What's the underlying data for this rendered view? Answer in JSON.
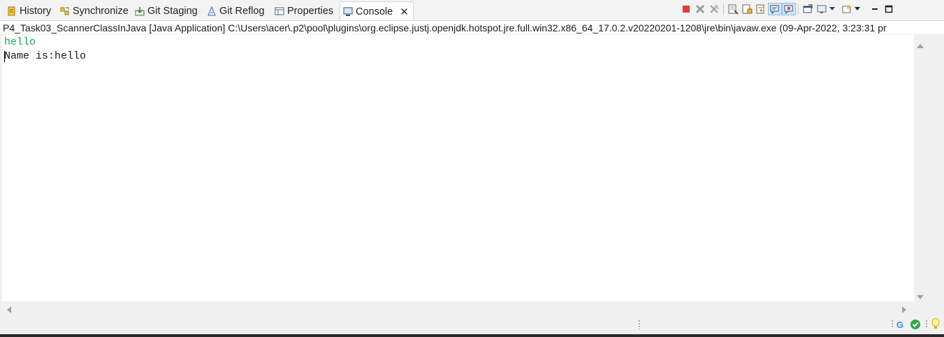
{
  "tabs": [
    {
      "label": "History",
      "icon": "history-icon"
    },
    {
      "label": "Synchronize",
      "icon": "synchronize-icon"
    },
    {
      "label": "Git Staging",
      "icon": "git-staging-icon"
    },
    {
      "label": "Git Reflog",
      "icon": "git-reflog-icon"
    },
    {
      "label": "Properties",
      "icon": "properties-icon"
    },
    {
      "label": "Console",
      "icon": "console-icon",
      "active": true
    }
  ],
  "toolbar_icons": [
    "terminate-icon",
    "remove-launch-icon",
    "remove-all-terminated-icon",
    "clear-console-icon",
    "scroll-lock-icon",
    "word-wrap-icon",
    "show-console-on-stdout-icon",
    "show-console-on-stderr-icon",
    "pin-console-icon",
    "display-selected-console-icon",
    "open-console-icon",
    "minimize-icon",
    "maximize-icon"
  ],
  "console": {
    "process_path": "P4_Task03_ScannerClassInJava [Java Application] C:\\Users\\acer\\.p2\\pool\\plugins\\org.eclipse.justj.openjdk.hotspot.jre.full.win32.x86_64_17.0.2.v20220201-1208\\jre\\bin\\javaw.exe  (09-Apr-2022, 3:23:31 pr",
    "input_line": "hello",
    "output_line": "Name is:hello"
  },
  "status": {
    "google_icon": "G",
    "icons": [
      "google-icon",
      "check-status-icon",
      "lightbulb-icon"
    ]
  },
  "colors": {
    "input_text": "#1aaa55",
    "terminate": "#e53935",
    "selected_toggle": "#cfe3f7"
  }
}
